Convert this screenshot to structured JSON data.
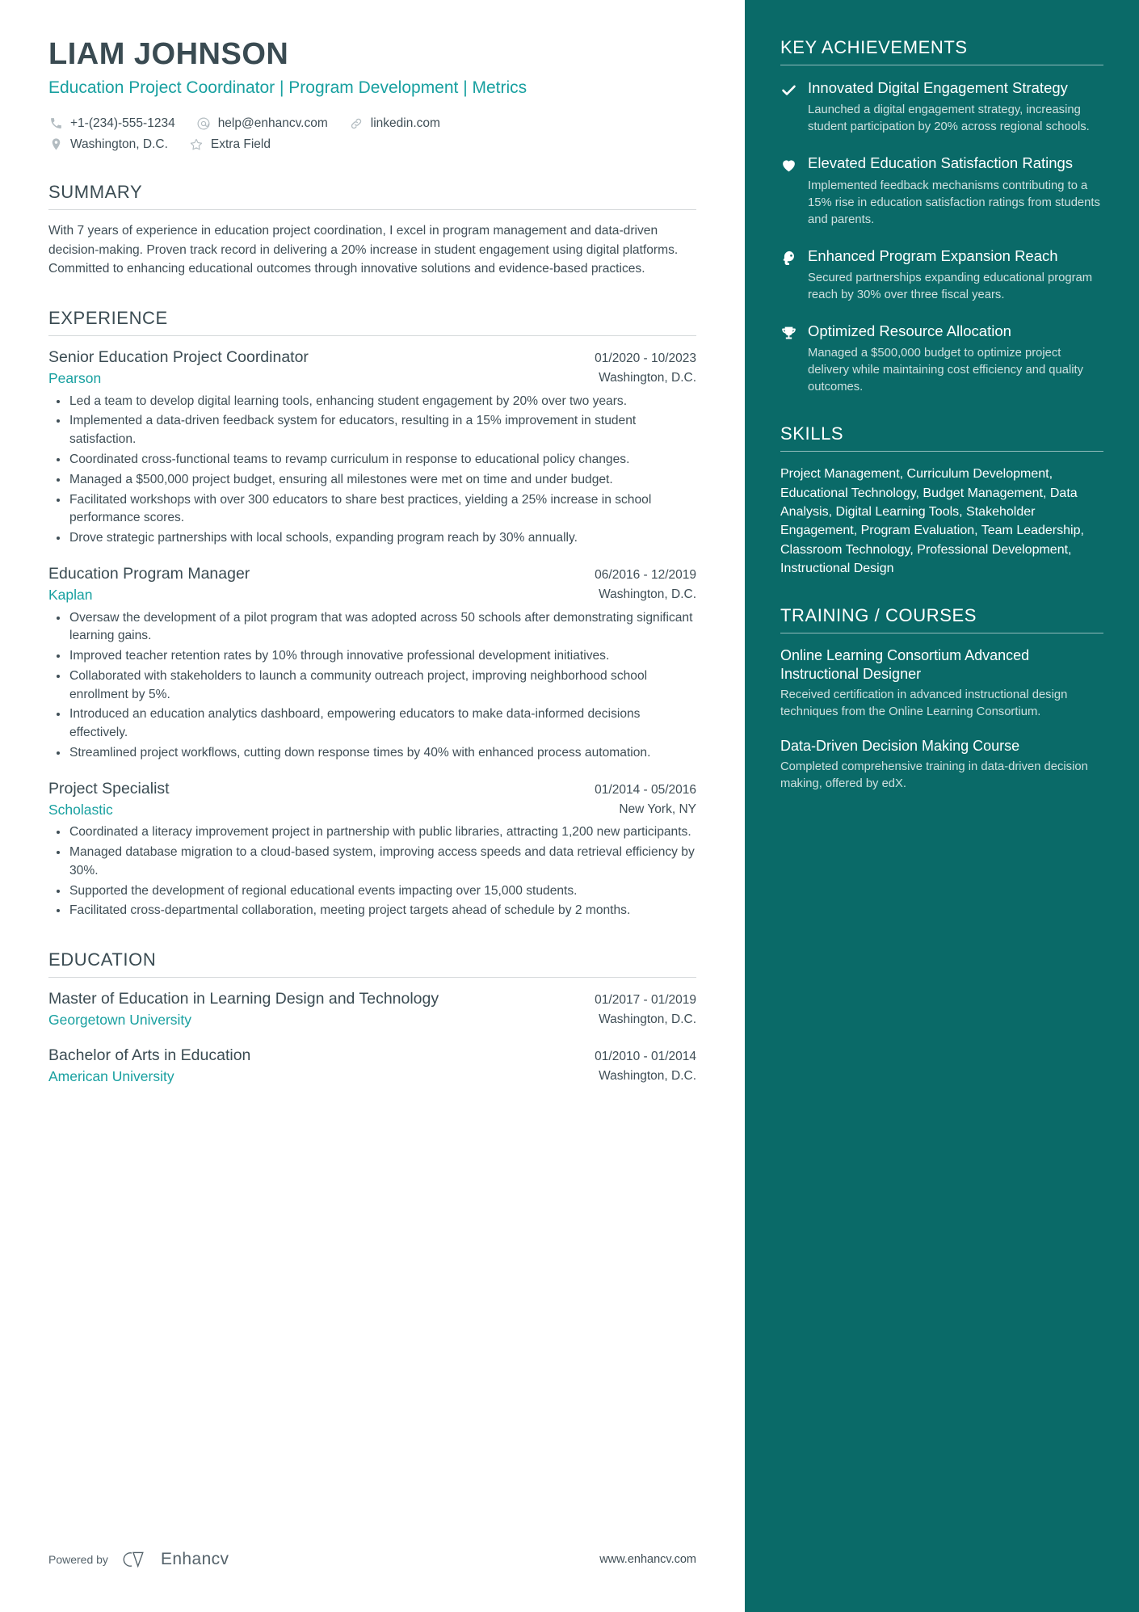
{
  "theme": {
    "accent_teal": "#18a0a0",
    "sidebar_bg": "#0a6a68",
    "text_dark": "#3f4e56",
    "heading_dark": "#3a4b52",
    "sidebar_muted": "#cfe0df"
  },
  "header": {
    "name": "LIAM JOHNSON",
    "headline": "Education Project Coordinator | Program Development | Metrics",
    "contacts_row1": [
      {
        "icon": "phone-icon",
        "text": "+1-(234)-555-1234"
      },
      {
        "icon": "email-icon",
        "text": "help@enhancv.com"
      },
      {
        "icon": "link-icon",
        "text": "linkedin.com"
      }
    ],
    "contacts_row2": [
      {
        "icon": "location-pin-icon",
        "text": "Washington, D.C."
      },
      {
        "icon": "star-icon",
        "text": "Extra Field"
      }
    ]
  },
  "summary": {
    "title": "SUMMARY",
    "text": "With 7 years of experience in education project coordination, I excel in program management and data-driven decision-making. Proven track record in delivering a 20% increase in student engagement using digital platforms. Committed to enhancing educational outcomes through innovative solutions and evidence-based practices."
  },
  "experience": {
    "title": "EXPERIENCE",
    "entries": [
      {
        "role": "Senior Education Project Coordinator",
        "date": "01/2020 - 10/2023",
        "company": "Pearson",
        "location": "Washington, D.C.",
        "bullets": [
          "Led a team to develop digital learning tools, enhancing student engagement by 20% over two years.",
          "Implemented a data-driven feedback system for educators, resulting in a 15% improvement in student satisfaction.",
          "Coordinated cross-functional teams to revamp curriculum in response to educational policy changes.",
          "Managed a $500,000 project budget, ensuring all milestones were met on time and under budget.",
          "Facilitated workshops with over 300 educators to share best practices, yielding a 25% increase in school performance scores.",
          "Drove strategic partnerships with local schools, expanding program reach by 30% annually."
        ]
      },
      {
        "role": "Education Program Manager",
        "date": "06/2016 - 12/2019",
        "company": "Kaplan",
        "location": "Washington, D.C.",
        "bullets": [
          "Oversaw the development of a pilot program that was adopted across 50 schools after demonstrating significant learning gains.",
          "Improved teacher retention rates by 10% through innovative professional development initiatives.",
          "Collaborated with stakeholders to launch a community outreach project, improving neighborhood school enrollment by 5%.",
          "Introduced an education analytics dashboard, empowering educators to make data-informed decisions effectively.",
          "Streamlined project workflows, cutting down response times by 40% with enhanced process automation."
        ]
      },
      {
        "role": "Project Specialist",
        "date": "01/2014 - 05/2016",
        "company": "Scholastic",
        "location": "New York, NY",
        "bullets": [
          "Coordinated a literacy improvement project in partnership with public libraries, attracting 1,200 new participants.",
          "Managed database migration to a cloud-based system, improving access speeds and data retrieval efficiency by 30%.",
          "Supported the development of regional educational events impacting over 15,000 students.",
          "Facilitated cross-departmental collaboration, meeting project targets ahead of schedule by 2 months."
        ]
      }
    ]
  },
  "education": {
    "title": "EDUCATION",
    "entries": [
      {
        "degree": "Master of Education in Learning Design and Technology",
        "date": "01/2017 - 01/2019",
        "school": "Georgetown University",
        "location": "Washington, D.C."
      },
      {
        "degree": "Bachelor of Arts in Education",
        "date": "01/2010 - 01/2014",
        "school": "American University",
        "location": "Washington, D.C."
      }
    ]
  },
  "key_achievements": {
    "title": "KEY ACHIEVEMENTS",
    "items": [
      {
        "icon": "check-icon",
        "title": "Innovated Digital Engagement Strategy",
        "desc": "Launched a digital engagement strategy, increasing student participation by 20% across regional schools."
      },
      {
        "icon": "heart-icon",
        "title": "Elevated Education Satisfaction Ratings",
        "desc": "Implemented feedback mechanisms contributing to a 15% rise in education satisfaction ratings from students and parents."
      },
      {
        "icon": "head-idea-icon",
        "title": "Enhanced Program Expansion Reach",
        "desc": "Secured partnerships expanding educational program reach by 30% over three fiscal years."
      },
      {
        "icon": "trophy-icon",
        "title": "Optimized Resource Allocation",
        "desc": "Managed a $500,000 budget to optimize project delivery while maintaining cost efficiency and quality outcomes."
      }
    ]
  },
  "skills": {
    "title": "SKILLS",
    "text": "Project Management, Curriculum Development, Educational Technology, Budget Management, Data Analysis, Digital Learning Tools, Stakeholder Engagement, Program Evaluation, Team Leadership, Classroom Technology, Professional Development, Instructional Design"
  },
  "training": {
    "title": "TRAINING / COURSES",
    "items": [
      {
        "title": "Online Learning Consortium Advanced Instructional Designer",
        "desc": "Received certification in advanced instructional design techniques from the Online Learning Consortium."
      },
      {
        "title": "Data-Driven Decision Making Course",
        "desc": "Completed comprehensive training in data-driven decision making, offered by edX."
      }
    ]
  },
  "footer": {
    "powered_by": "Powered by",
    "brand": "Enhancv",
    "website": "www.enhancv.com"
  }
}
